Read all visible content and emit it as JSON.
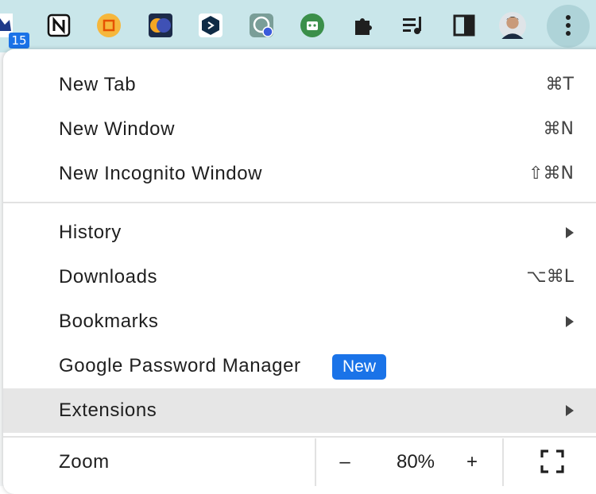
{
  "toolbar": {
    "badge_count": "15",
    "icons": [
      "confluence-icon",
      "notion-icon",
      "screenshot-extension-icon",
      "brain-extension-icon",
      "deepl-icon",
      "openai-extension-icon",
      "android-robot-icon",
      "puzzle-icon",
      "media-control-icon",
      "side-panel-icon",
      "profile-avatar",
      "more-menu-icon"
    ]
  },
  "menu": {
    "new_tab": {
      "label": "New Tab",
      "shortcut": "⌘T"
    },
    "new_window": {
      "label": "New Window",
      "shortcut": "⌘N"
    },
    "new_incognito": {
      "label": "New Incognito Window",
      "shortcut": "⇧⌘N"
    },
    "history": {
      "label": "History"
    },
    "downloads": {
      "label": "Downloads",
      "shortcut": "⌥⌘L"
    },
    "bookmarks": {
      "label": "Bookmarks"
    },
    "password_manager": {
      "label": "Google Password Manager",
      "badge": "New"
    },
    "extensions": {
      "label": "Extensions"
    },
    "zoom": {
      "label": "Zoom",
      "minus": "–",
      "value": "80%",
      "plus": "+"
    }
  },
  "colors": {
    "accent": "#1a73e8",
    "toolbar_bg": "#c9e6ea",
    "highlight": "#e6e6e6"
  }
}
